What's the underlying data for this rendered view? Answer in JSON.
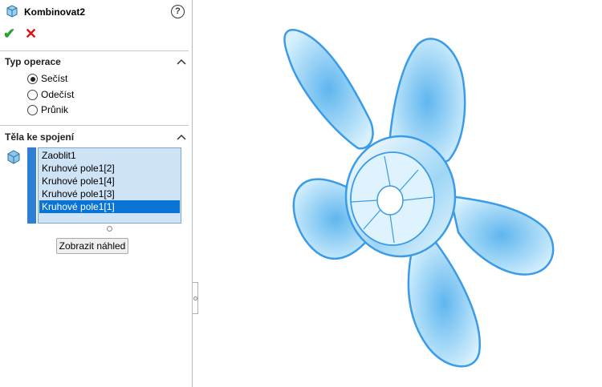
{
  "feature": {
    "title": "Kombinovat2",
    "help_icon": "help-icon",
    "ok_icon": "checkmark-icon",
    "cancel_icon": "close-icon",
    "help_glyph": "?",
    "ok_glyph": "✔",
    "cancel_glyph": "✕"
  },
  "operation_type": {
    "title": "Typ operace",
    "options": [
      {
        "label": "Sečíst",
        "selected": true
      },
      {
        "label": "Odečíst",
        "selected": false
      },
      {
        "label": "Průnik",
        "selected": false
      }
    ]
  },
  "bodies": {
    "title": "Těla ke spojení",
    "items": [
      {
        "label": "Zaoblit1",
        "selected": false
      },
      {
        "label": "Kruhové pole1[2]",
        "selected": false
      },
      {
        "label": "Kruhové pole1[4]",
        "selected": false
      },
      {
        "label": "Kruhové pole1[3]",
        "selected": false
      },
      {
        "label": "Kruhové pole1[1]",
        "selected": true
      }
    ],
    "preview_button": "Zobrazit náhled"
  },
  "colors": {
    "accent": "#0a74d6",
    "list_background": "#cfe3f7",
    "model_edge": "#3a9be8",
    "model_fill": "#bfe6fb"
  }
}
